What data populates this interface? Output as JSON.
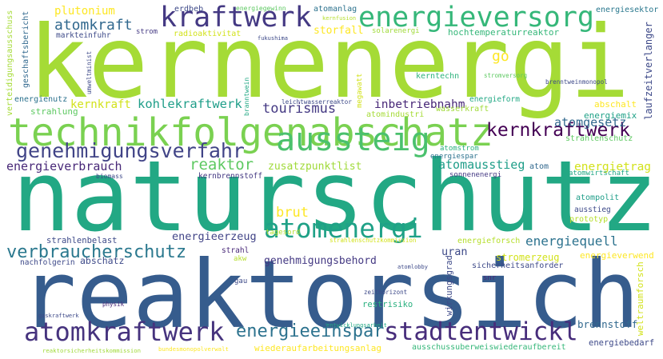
{
  "words": [
    {
      "text": "kernenergi",
      "color": "#a5db36"
    },
    {
      "text": "naturschutz",
      "color": "#22a884"
    },
    {
      "text": "reaktorsich",
      "color": "#365c8d"
    },
    {
      "text": "technikfolgenabschatz",
      "color": "#7ad151"
    },
    {
      "text": "kraftwerk",
      "color": "#443983"
    },
    {
      "text": "energieversorg",
      "color": "#35b779"
    },
    {
      "text": "genehmigungsverfahr",
      "color": "#414487"
    },
    {
      "text": "aussteig",
      "color": "#4ac16d"
    },
    {
      "text": "kernkraftwerk",
      "color": "#440154"
    },
    {
      "text": "atomenergi",
      "color": "#1fa187"
    },
    {
      "text": "verbraucherschutz",
      "color": "#2a788e"
    },
    {
      "text": "atomkraftwerk",
      "color": "#46337e"
    },
    {
      "text": "stadtentwickl",
      "color": "#472d7b"
    },
    {
      "text": "energieeinspar",
      "color": "#2c728e"
    },
    {
      "text": "plutonium",
      "color": "#fde725"
    },
    {
      "text": "erdbeb",
      "color": "#3e4a89"
    },
    {
      "text": "energiegewinn",
      "color": "#5ec962"
    },
    {
      "text": "atomanlag",
      "color": "#2c728e"
    },
    {
      "text": "energiesektor",
      "color": "#2a788e"
    },
    {
      "text": "kernfusion",
      "color": "#b5de2b"
    },
    {
      "text": "atomkraft",
      "color": "#31688e"
    },
    {
      "text": "storfall",
      "color": "#fde725"
    },
    {
      "text": "solarenergi",
      "color": "#a0da39"
    },
    {
      "text": "hochtemperaturreaktor",
      "color": "#35b779"
    },
    {
      "text": "markteinfuhr",
      "color": "#3e4a89"
    },
    {
      "text": "strom",
      "color": "#443983"
    },
    {
      "text": "radioaktivitat",
      "color": "#d2e21b"
    },
    {
      "text": "fukushima",
      "color": "#3e4a89"
    },
    {
      "text": "verteidigungsausschuss",
      "color": "#a5db36"
    },
    {
      "text": "geschaftsbericht",
      "color": "#31688e"
    },
    {
      "text": "umweltminist",
      "color": "#3e4a89"
    },
    {
      "text": "branntwein",
      "color": "#22a884"
    },
    {
      "text": "megawatt",
      "color": "#d2e21b"
    },
    {
      "text": "laufzeitverlanger",
      "color": "#3e4a89"
    },
    {
      "text": "weltraumforsch",
      "color": "#d2e21b"
    },
    {
      "text": "wirkungsgrad",
      "color": "#3e4a89"
    },
    {
      "text": "go",
      "color": "#fde725"
    },
    {
      "text": "kerntechn",
      "color": "#2eb37c"
    },
    {
      "text": "stromversorg",
      "color": "#5ec962"
    },
    {
      "text": "brenntweinmonopol",
      "color": "#3e4a89"
    },
    {
      "text": "energienutz",
      "color": "#2c728e"
    },
    {
      "text": "leichtwasserreaktor",
      "color": "#3e4a89"
    },
    {
      "text": "strahlung",
      "color": "#5ec962"
    },
    {
      "text": "kernkraft",
      "color": "#d2e21b"
    },
    {
      "text": "kohlekraftwerk",
      "color": "#1f9e89"
    },
    {
      "text": "tourismus",
      "color": "#443983"
    },
    {
      "text": "inbetriebnahm",
      "color": "#482878"
    },
    {
      "text": "energieform",
      "color": "#22a884"
    },
    {
      "text": "abschalt",
      "color": "#fde725"
    },
    {
      "text": "energiemix",
      "color": "#1fa187"
    },
    {
      "text": "wasserkraft",
      "color": "#a0da39"
    },
    {
      "text": "atomindustri",
      "color": "#a5db36"
    },
    {
      "text": "atomgesetz",
      "color": "#31688e"
    },
    {
      "text": "strahlenschutz",
      "color": "#5ec962"
    },
    {
      "text": "energieverbrauch",
      "color": "#482878"
    },
    {
      "text": "reaktor",
      "color": "#5ec962"
    },
    {
      "text": "biomass",
      "color": "#3e4a89"
    },
    {
      "text": "zusatzpunktlist",
      "color": "#a0da39"
    },
    {
      "text": "kernbrennstoff",
      "color": "#443983"
    },
    {
      "text": "atomstrom",
      "color": "#2ab07f"
    },
    {
      "text": "energiespar",
      "color": "#2c728e"
    },
    {
      "text": "atomausstieg",
      "color": "#1f9e89"
    },
    {
      "text": "atom",
      "color": "#31688e"
    },
    {
      "text": "energietrag",
      "color": "#d2e21b"
    },
    {
      "text": "sonnenenergi",
      "color": "#443983"
    },
    {
      "text": "atomwirtschaft",
      "color": "#22a884"
    },
    {
      "text": "atompolit",
      "color": "#1f9e89"
    },
    {
      "text": "ausstieg",
      "color": "#3e4a89"
    },
    {
      "text": "prototyp",
      "color": "#b5de2b"
    },
    {
      "text": "brut",
      "color": "#fde725"
    },
    {
      "text": "tagesord",
      "color": "#b5de2b"
    },
    {
      "text": "strahlenbelast",
      "color": "#3e4a89"
    },
    {
      "text": "energieerzeug",
      "color": "#414487"
    },
    {
      "text": "strahlenschutzkommission",
      "color": "#d2e21b"
    },
    {
      "text": "energieforsch",
      "color": "#b5de2b"
    },
    {
      "text": "energiequell",
      "color": "#2c728e"
    },
    {
      "text": "strahl",
      "color": "#482878"
    },
    {
      "text": "akw",
      "color": "#b5de2b"
    },
    {
      "text": "nachfolgerin",
      "color": "#3e4a89"
    },
    {
      "text": "abschatz",
      "color": "#3e4a89"
    },
    {
      "text": "genehmigungsbehord",
      "color": "#443983"
    },
    {
      "text": "uran",
      "color": "#3e4a89"
    },
    {
      "text": "stromerzeug",
      "color": "#d2e21b"
    },
    {
      "text": "energieverwend",
      "color": "#fde725"
    },
    {
      "text": "atomlobby",
      "color": "#3e4a89"
    },
    {
      "text": "sicherheitsanforder",
      "color": "#3e4a89"
    },
    {
      "text": "gau",
      "color": "#3e4a89"
    },
    {
      "text": "snr",
      "color": "#482878"
    },
    {
      "text": "zeithorizont",
      "color": "#3e4a89"
    },
    {
      "text": "physik",
      "color": "#482878"
    },
    {
      "text": "restrisiko",
      "color": "#2ab07f"
    },
    {
      "text": "gaskraftwerk",
      "color": "#3e4a89"
    },
    {
      "text": "entwicklungsarbeit",
      "color": "#22a884"
    },
    {
      "text": "brennstoff",
      "color": "#31688e"
    },
    {
      "text": "wiederaufarbeitungsanlag",
      "color": "#fde725"
    },
    {
      "text": "reaktorsicherheitskommission",
      "color": "#a0da39"
    },
    {
      "text": "bundesmonopolverwalt",
      "color": "#fde725"
    },
    {
      "text": "ausschussuberweiswiederaufbereit",
      "color": "#35b779"
    },
    {
      "text": "energiebedarf",
      "color": "#3e4a89"
    }
  ]
}
